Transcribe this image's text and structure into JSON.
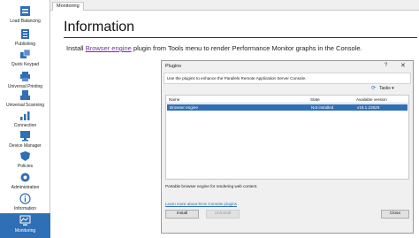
{
  "nav": {
    "items": [
      {
        "label": "Load Balancing",
        "icon": "load-balancing-icon"
      },
      {
        "label": "Publishing",
        "icon": "publishing-icon"
      },
      {
        "label": "Quick Keypad",
        "icon": "quick-keypad-icon"
      },
      {
        "label": "Universal Printing",
        "icon": "printer-icon"
      },
      {
        "label": "Universal Scanning",
        "icon": "scanner-icon"
      },
      {
        "label": "Connection",
        "icon": "connection-icon"
      },
      {
        "label": "Device Manager",
        "icon": "device-manager-icon"
      },
      {
        "label": "Policies",
        "icon": "policies-icon"
      },
      {
        "label": "Administration",
        "icon": "administration-icon"
      },
      {
        "label": "Information",
        "icon": "information-icon"
      },
      {
        "label": "Monitoring",
        "icon": "monitoring-icon"
      }
    ],
    "selected": "Monitoring"
  },
  "tab": {
    "label": "Monitoring"
  },
  "main": {
    "heading": "Information",
    "info_prefix": "Install ",
    "info_link": "Browser engine",
    "info_suffix": " plugin from Tools menu to render Performance Monitor graphs in the Console."
  },
  "dialog": {
    "title": "Plugins",
    "help_label": "?",
    "close_label": "✕",
    "description": "Use the plugins to enhance the Parallels Remote Application Server Console.",
    "tasks_label": "Tasks",
    "columns": [
      "Name",
      "State",
      "Available version"
    ],
    "rows": [
      {
        "name": "Browser engine",
        "state": "Not installed",
        "version": "v18.1.22629"
      }
    ],
    "plugin_description": "Portable browser engine for rendering web content.",
    "learn_more": "Learn more about RAS Console plugins",
    "install_label": "Install",
    "uninstall_label": "Uninstall",
    "close_button_label": "Close"
  },
  "colors": {
    "accent": "#2f6fb5",
    "link": "#7030a0"
  }
}
